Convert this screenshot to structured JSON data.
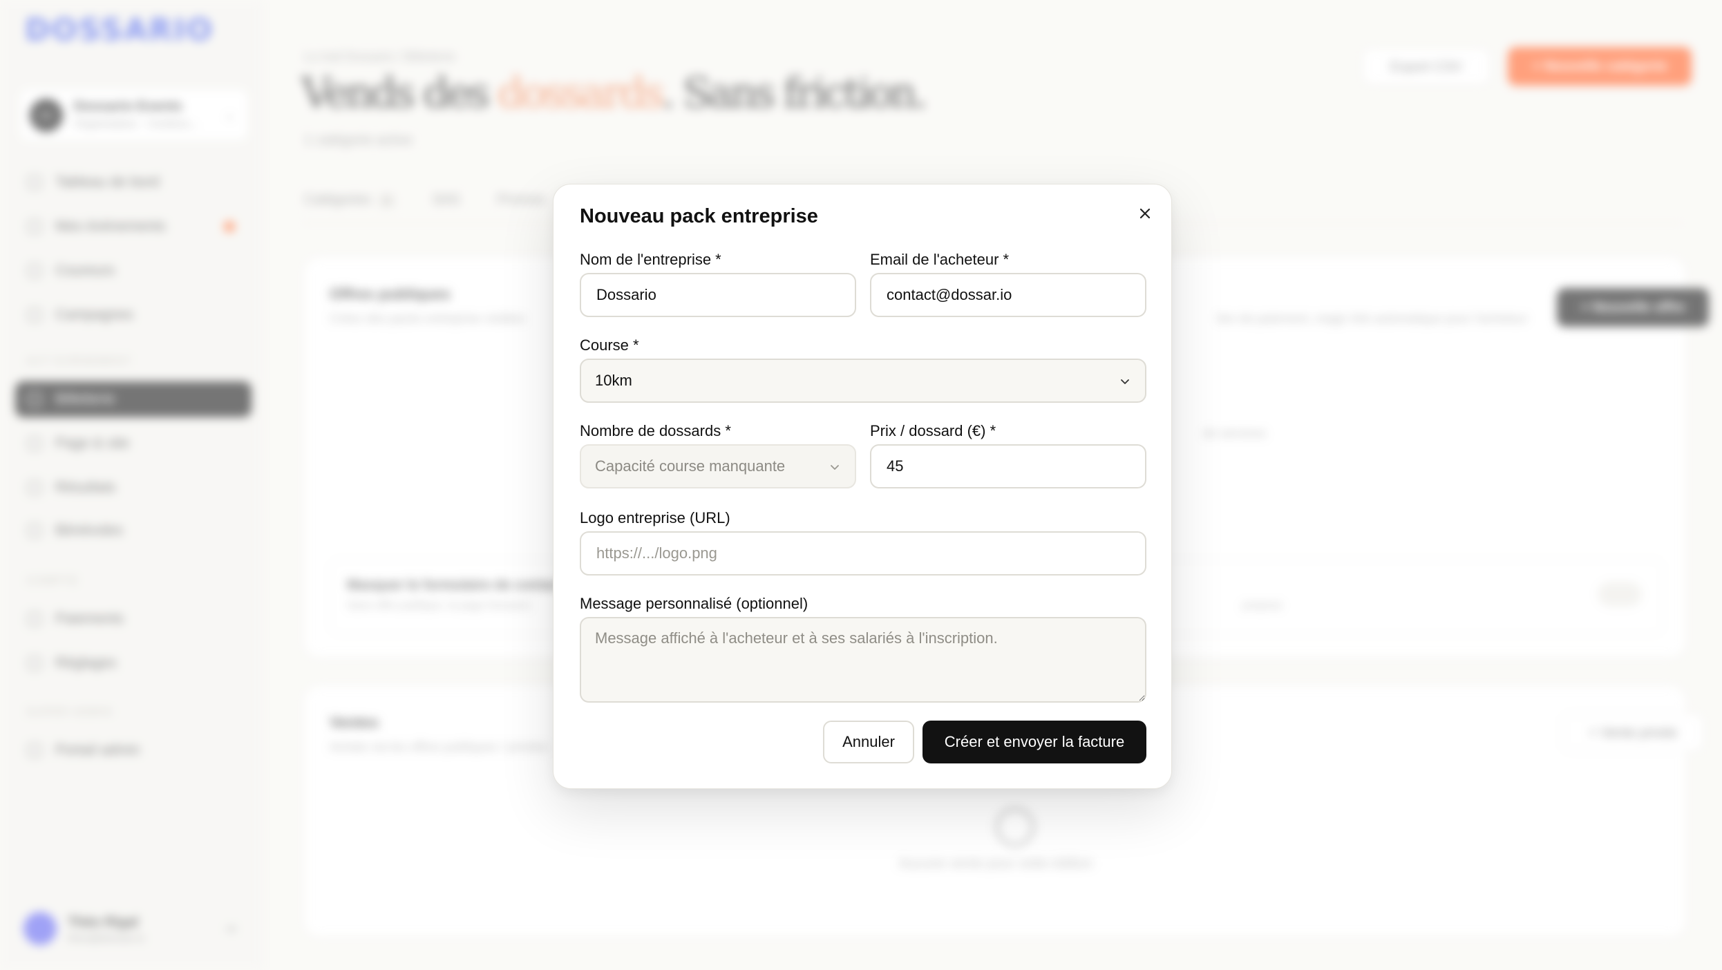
{
  "background": {
    "logo_text": "DOSSARIO",
    "org": {
      "initials": "DE",
      "name": "Dossario Events",
      "subtitle": "Organisateur · Contenu..."
    },
    "nav": [
      {
        "label": "Tableau de bord"
      },
      {
        "label": "Mes événements",
        "badge": true
      },
      {
        "label": "Coureurs"
      },
      {
        "label": "Campagnes"
      }
    ],
    "section_event": "ACT EVÉNEMENT",
    "nav_event": [
      {
        "label": "Billetterie",
        "active": true
      },
      {
        "label": "Page & site"
      },
      {
        "label": "Résultats"
      },
      {
        "label": "Bénévoles"
      }
    ],
    "section_account": "COMPTE",
    "nav_account": [
      {
        "label": "Paiements"
      },
      {
        "label": "Réglages"
      }
    ],
    "section_admin": "SUPER ADMIN",
    "nav_admin": [
      {
        "label": "Portail admin"
      }
    ],
    "user": {
      "name": "Théo Rigal",
      "email": "theo@dossar.io"
    },
    "breadcrumb": "Le trail Dossario / Billetterie",
    "hero_before": "Vends des ",
    "hero_accent": "dossards",
    "hero_after": ". Sans friction.",
    "hero_sub": "1 catégorie active",
    "export_label": "Export CSV",
    "new_category_label": "+ Nouvelle catégorie",
    "tabs": [
      {
        "label": "Catégories",
        "count": "3"
      },
      {
        "label": "SAS"
      },
      {
        "label": "Promos"
      }
    ],
    "offers_card": {
      "title": "Offres publiques",
      "subtitle": "Créez des packs entreprise visibles",
      "subtitle_right": "lien de paiement, magic link automatique pour l'acheteur",
      "middle_text": "de services",
      "button": "+ Nouvelle offre",
      "toggle_title": "Masquer le formulaire de contact",
      "toggle_sub": "Sans offre publique, la page Dossario",
      "toggle_sub_right": "propose"
    },
    "sales_card": {
      "title": "Ventes",
      "subtitle": "Achats via les offres publiques / privées",
      "button": "+ Vente privée",
      "empty": "Aucune vente pour cette édition"
    }
  },
  "modal": {
    "title": "Nouveau pack entreprise",
    "company_label": "Nom de l'entreprise *",
    "company_value": "Dossario",
    "email_label": "Email de l'acheteur *",
    "email_value": "contact@dossar.io",
    "course_label": "Course *",
    "course_value": "10km",
    "count_label": "Nombre de dossards *",
    "count_value": "Capacité course manquante",
    "price_label": "Prix / dossard (€) *",
    "price_value": "45",
    "logo_label": "Logo entreprise (URL)",
    "logo_placeholder": "https://.../logo.png",
    "message_label": "Message personnalisé (optionnel)",
    "message_placeholder": "Message affiché à l'acheteur et à ses salariés à l'inscription.",
    "cancel_label": "Annuler",
    "submit_label": "Créer et envoyer la facture"
  }
}
